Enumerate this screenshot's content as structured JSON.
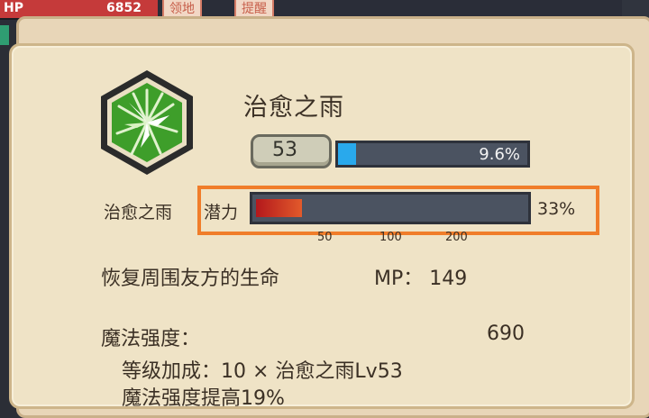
{
  "hud": {
    "hp_label": "HP",
    "hp_value": "6852",
    "tag1": "领地",
    "tag2": "提醒"
  },
  "skill": {
    "name": "治愈之雨",
    "icon": "healing-rain-icon",
    "level": "53",
    "level_progress": 0.096,
    "level_pct_text": "9.6%"
  },
  "potential": {
    "skill_label": "治愈之雨",
    "label": "潜力",
    "progress": 0.17,
    "pct_text": "33%",
    "ticks": [
      "50",
      "100",
      "200"
    ]
  },
  "description": {
    "text": "恢复周围友方的生命",
    "mp_label": "MP：",
    "mp_value": "149"
  },
  "stats": {
    "label": "魔法强度：",
    "value": "690",
    "line1": "等级加成：10 × 治愈之雨Lv53",
    "line2": "魔法强度提高19%"
  },
  "colors": {
    "accent_blue": "#29a9ec",
    "highlight_orange": "#f07d2a",
    "potential_red": "#c2261f",
    "icon_green": "#3e9e2a"
  }
}
